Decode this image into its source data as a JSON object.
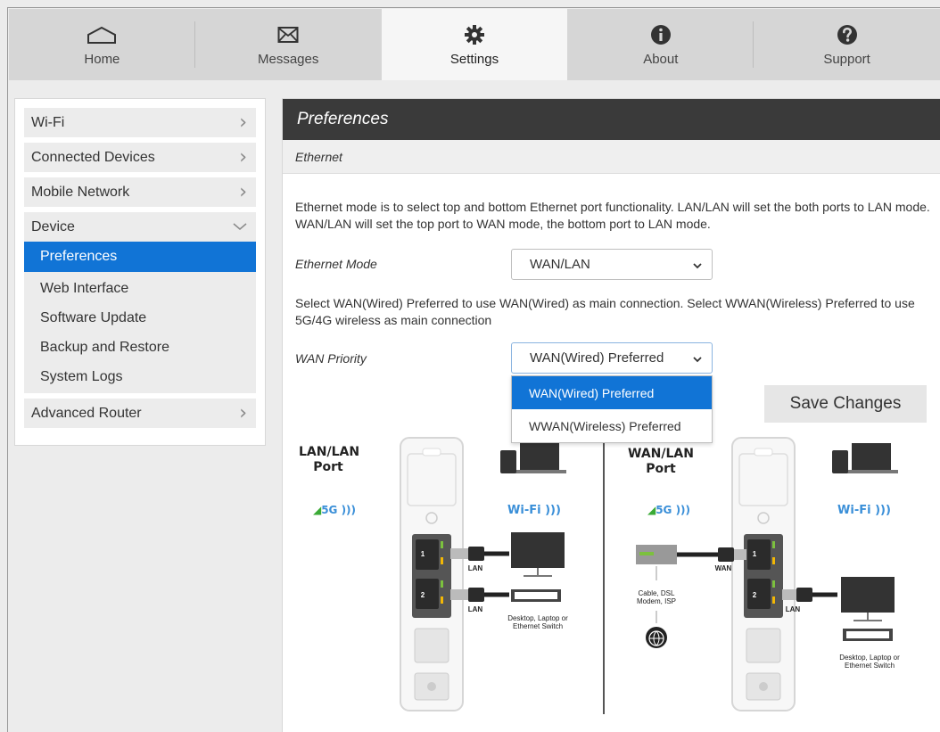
{
  "tabs": [
    {
      "label": "Home",
      "icon": "home-icon"
    },
    {
      "label": "Messages",
      "icon": "envelope-icon"
    },
    {
      "label": "Settings",
      "icon": "gear-icon"
    },
    {
      "label": "About",
      "icon": "info-icon"
    },
    {
      "label": "Support",
      "icon": "question-icon"
    }
  ],
  "active_tab": "Settings",
  "sidebar": {
    "items": [
      {
        "label": "Wi-Fi"
      },
      {
        "label": "Connected Devices"
      },
      {
        "label": "Mobile Network"
      },
      {
        "label": "Device"
      },
      {
        "label": "Advanced Router"
      }
    ],
    "device_subitems": [
      {
        "label": "Preferences"
      },
      {
        "label": "Web Interface"
      },
      {
        "label": "Software Update"
      },
      {
        "label": "Backup and Restore"
      },
      {
        "label": "System Logs"
      }
    ],
    "selected_subitem": "Preferences"
  },
  "main": {
    "title": "Preferences",
    "section": "Ethernet",
    "ethernet_description": "Ethernet mode is to select top and bottom Ethernet port functionality. LAN/LAN will set the both ports to LAN mode. WAN/LAN will set the top port to WAN mode, the bottom port to LAN mode.",
    "ethernet_mode_label": "Ethernet Mode",
    "ethernet_mode_value": "WAN/LAN",
    "wan_description": "Select WAN(Wired) Preferred to use WAN(Wired) as main connection. Select WWAN(Wireless) Preferred to use 5G/4G wireless as main connection",
    "wan_priority_label": "WAN Priority",
    "wan_priority_value": "WAN(Wired) Preferred",
    "wan_priority_options": [
      "WAN(Wired) Preferred",
      "WWAN(Wireless) Preferred"
    ],
    "save_button": "Save Changes"
  },
  "diagram": {
    "left_title": "LAN/LAN\nPort",
    "right_title": "WAN/LAN\nPort",
    "fiveg": "5G",
    "wifi": "Wi-Fi",
    "port1": "1",
    "port2": "2",
    "lan": "LAN",
    "wan": "WAN",
    "desktop_caption": "Desktop, Laptop or\nEthernet Switch",
    "modem_caption": "Cable, DSL\nModem, ISP"
  },
  "colors": {
    "accent": "#1174d6",
    "header_bg": "#3a3a3a",
    "tab_bg": "#d6d6d6",
    "active_tab_bg": "#f6f6f6",
    "signal_green": "#3aaa35",
    "wifi_blue": "#3a8fd8"
  }
}
